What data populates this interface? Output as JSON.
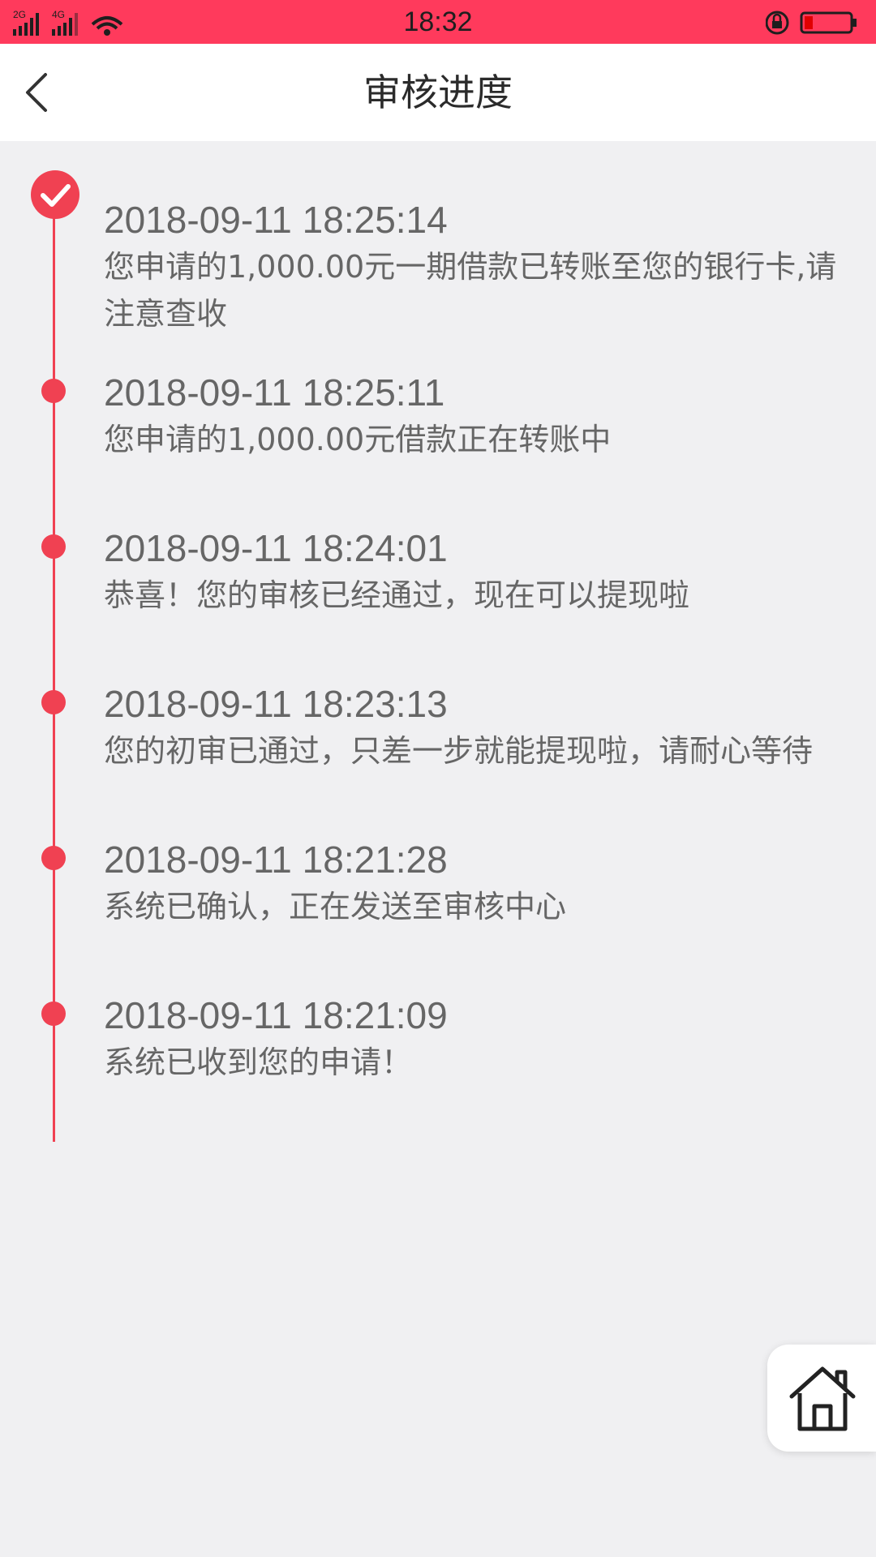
{
  "status_bar": {
    "time": "18:32",
    "signal_labels": [
      "2G",
      "4G"
    ],
    "color": "#ff3a5c"
  },
  "nav": {
    "title": "审核进度",
    "back_icon": "chevron-left-icon"
  },
  "timeline": {
    "accent_color": "#f04152",
    "items": [
      {
        "time": "2018-09-11 18:25:14",
        "desc": "您申请的1,000.00元一期借款已转账至您的银行卡,请注意查收",
        "state": "done-check"
      },
      {
        "time": "2018-09-11 18:25:11",
        "desc": "您申请的1,000.00元借款正在转账中",
        "state": "dot"
      },
      {
        "time": "2018-09-11 18:24:01",
        "desc": "恭喜！您的审核已经通过，现在可以提现啦",
        "state": "dot"
      },
      {
        "time": "2018-09-11 18:23:13",
        "desc": "您的初审已通过，只差一步就能提现啦，请耐心等待",
        "state": "dot"
      },
      {
        "time": "2018-09-11 18:21:28",
        "desc": "系统已确认，正在发送至审核中心",
        "state": "dot"
      },
      {
        "time": "2018-09-11 18:21:09",
        "desc": "系统已收到您的申请！",
        "state": "dot"
      }
    ]
  },
  "home_button": {
    "icon": "home-icon"
  }
}
